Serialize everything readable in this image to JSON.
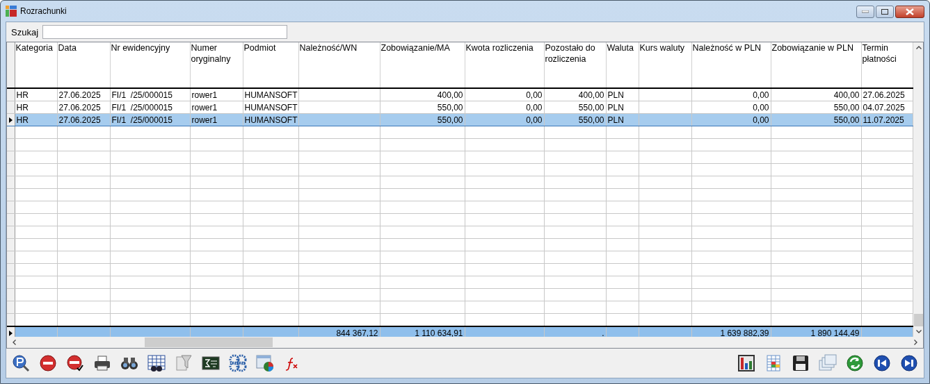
{
  "window": {
    "title": "Rozrachunki"
  },
  "search": {
    "label": "Szukaj"
  },
  "table": {
    "columns": [
      "Kategoria",
      "Data",
      "Nr ewidencyjny",
      "Numer oryginalny",
      "Podmiot",
      "Należność/WN",
      "Zobowiązanie/MA",
      "Kwota rozliczenia",
      "Pozostało do rozliczenia",
      "Waluta",
      "Kurs waluty",
      "Należność w PLN",
      "Zobowiązanie w PLN",
      "Termin płatności"
    ],
    "rows": [
      {
        "selected": false,
        "cells": [
          "HR",
          "27.06.2025",
          "FI/1  /25/000015",
          "rower1",
          "HUMANSOFT",
          null,
          "400,00",
          "0,00",
          "400,00",
          "PLN",
          null,
          "0,00",
          "400,00",
          "27.06.2025"
        ]
      },
      {
        "selected": false,
        "cells": [
          "HR",
          "27.06.2025",
          "FI/1  /25/000015",
          "rower1",
          "HUMANSOFT",
          null,
          "550,00",
          "0,00",
          "550,00",
          "PLN",
          null,
          "0,00",
          "550,00",
          "04.07.2025"
        ]
      },
      {
        "selected": true,
        "cells": [
          "HR",
          "27.06.2025",
          "FI/1  /25/000015",
          "rower1",
          "HUMANSOFT",
          null,
          "550,00",
          "0,00",
          "550,00",
          "PLN",
          null,
          "0,00",
          "550,00",
          "11.07.2025"
        ]
      }
    ],
    "totals": [
      {
        "kind": "blank"
      },
      {
        "kind": "blank"
      },
      {
        "kind": "blank"
      },
      {
        "kind": "blank"
      },
      {
        "kind": "blank"
      },
      {
        "kind": "value",
        "text": "844 367,12"
      },
      {
        "kind": "value",
        "text": "1 110 634,91"
      },
      {
        "kind": "blank"
      },
      {
        "kind": "value",
        "text": "."
      },
      {
        "kind": "blank"
      },
      {
        "kind": "blank"
      },
      {
        "kind": "value",
        "text": "1 639 882,39"
      },
      {
        "kind": "value",
        "text": "1 890 144,49"
      },
      {
        "kind": "blank"
      }
    ]
  }
}
